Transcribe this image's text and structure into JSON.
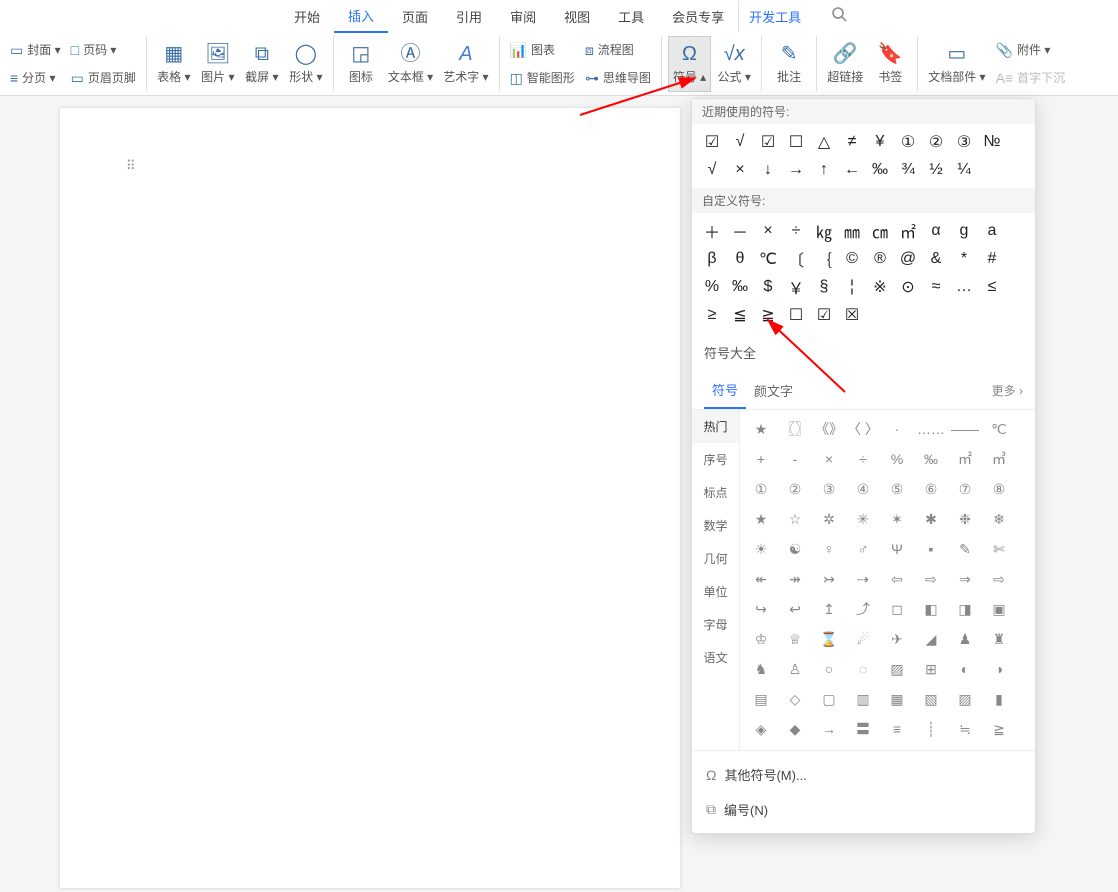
{
  "menu": {
    "tabs": [
      "开始",
      "插入",
      "页面",
      "引用",
      "审阅",
      "视图",
      "工具",
      "会员专享",
      "开发工具"
    ],
    "active": "插入"
  },
  "ribbon": {
    "cover": "封面 ▾",
    "page_num": "页码 ▾",
    "section": "分页 ▾",
    "header_footer": "页眉页脚",
    "table": "表格 ▾",
    "picture": "图片 ▾",
    "screenshot": "截屏 ▾",
    "shape": "形状 ▾",
    "icon": "图标",
    "textbox": "文本框 ▾",
    "wordart": "艺术字 ▾",
    "chart": "图表",
    "flowchart": "流程图",
    "smartart": "智能图形",
    "mindmap": "思维导图",
    "symbol": "符号 ▴",
    "formula": "公式 ▾",
    "comment": "批注",
    "hyperlink": "超链接",
    "bookmark": "书签",
    "doc_parts": "文档部件 ▾",
    "attachment": "附件 ▾",
    "dropcap": "首字下沉"
  },
  "popup": {
    "recent_header": "近期使用的符号:",
    "recent": [
      "☑",
      "√",
      "☑",
      "☐",
      "△",
      "≠",
      "¥",
      "①",
      "②",
      "③",
      "№",
      "√",
      "×",
      "↓",
      "→",
      "↑",
      "←",
      "‰",
      "¾",
      "½",
      "¼"
    ],
    "custom_header": "自定义符号:",
    "custom": [
      "＋",
      "－",
      "×",
      "÷",
      "㎏",
      "㎜",
      "㎝",
      "㎡",
      "α",
      "ɡ",
      "a",
      "β",
      "θ",
      "℃",
      "〔",
      "｛",
      "©",
      "®",
      "@",
      "&",
      "*",
      "#",
      "%",
      "‰",
      "$",
      "￥",
      "§",
      "¦",
      "※",
      "⊙",
      "≈",
      "…",
      "≤",
      "≥",
      "≦",
      "≧",
      "☐",
      "☑",
      "☒"
    ],
    "full_header": "符号大全",
    "tabs": {
      "symbols": "符号",
      "emoji": "颜文字",
      "more": "更多  ›"
    },
    "categories": [
      "热门",
      "序号",
      "标点",
      "数学",
      "几何",
      "单位",
      "字母",
      "语文"
    ],
    "catalog": [
      "★",
      "〖〗",
      "《》",
      "〈 〉",
      "·",
      "……",
      "——",
      "℃",
      "+",
      "-",
      "×",
      "÷",
      "%",
      "‰",
      "㎡",
      "㎥",
      "①",
      "②",
      "③",
      "④",
      "⑤",
      "⑥",
      "⑦",
      "⑧",
      "★",
      "☆",
      "✲",
      "✳",
      "✶",
      "✱",
      "❉",
      "❄",
      "☀",
      "☯",
      "♀",
      "♂",
      "Ψ",
      "▪",
      "✎",
      "✄",
      "↞",
      "↠",
      "↣",
      "⇢",
      "⇦",
      "⇨",
      "⇒",
      "⇨",
      "↪",
      "↩",
      "↥",
      "⤴",
      "◻",
      "◧",
      "◨",
      "▣",
      "♔",
      "♕",
      "⌛",
      "☄",
      "✈",
      "◢",
      "♟",
      "♜",
      "♞",
      "♙",
      "○",
      "◌",
      "▨",
      "⊞",
      "◐",
      "◑",
      "▤",
      "◇",
      "▢",
      "▥",
      "▦",
      "▧",
      "▨",
      "▮",
      "◈",
      "◆",
      "→",
      "〓",
      "≡",
      "┊",
      "≒",
      "≧"
    ],
    "footer": {
      "other": "其他符号(M)...",
      "numbering": "编号(N)"
    }
  }
}
